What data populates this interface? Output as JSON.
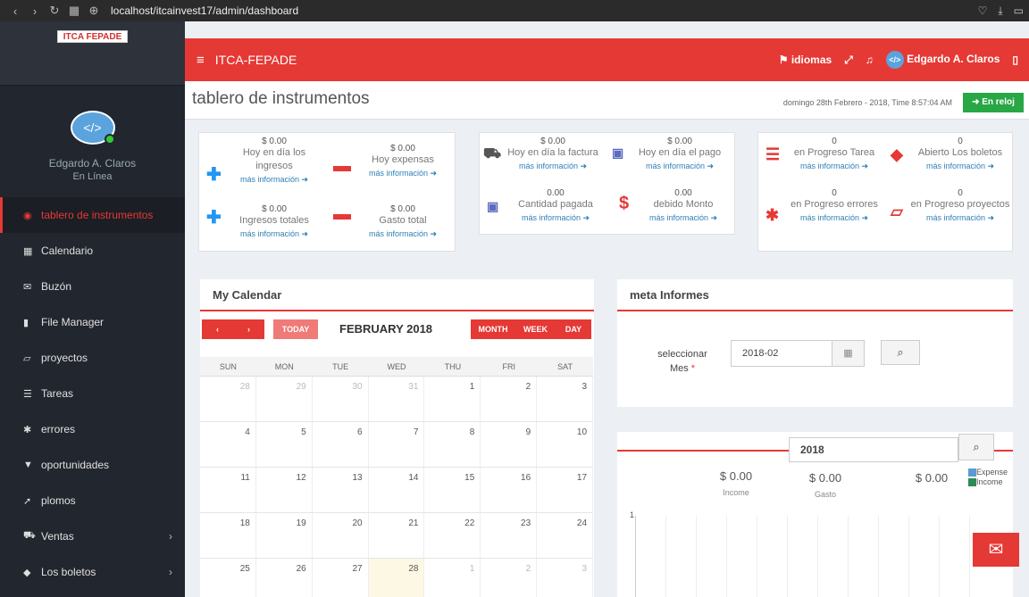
{
  "browser": {
    "url": "localhost/itcainvest17/admin/dashboard"
  },
  "sidebar": {
    "logo": "ITCA FEPADE",
    "user": "Edgardo A. Claros",
    "status": "En Línea",
    "items": [
      {
        "label": "tablero de instrumentos",
        "icon": "dashboard-icon"
      },
      {
        "label": "Calendario",
        "icon": "calendar-icon"
      },
      {
        "label": "Buzón",
        "icon": "envelope-icon"
      },
      {
        "label": "File Manager",
        "icon": "file-icon"
      },
      {
        "label": "proyectos",
        "icon": "folder-icon"
      },
      {
        "label": "Tareas",
        "icon": "tasks-icon"
      },
      {
        "label": "errores",
        "icon": "bug-icon"
      },
      {
        "label": "oportunidades",
        "icon": "filter-icon"
      },
      {
        "label": "plomos",
        "icon": "rocket-icon"
      },
      {
        "label": "Ventas",
        "icon": "cart-icon"
      },
      {
        "label": "Los boletos",
        "icon": "ticket-icon"
      }
    ]
  },
  "topbar": {
    "brand": "ITCA-FEPADE",
    "lang": "idiomas",
    "user": "Edgardo A. Claros"
  },
  "header": {
    "title": "tablero de instrumentos",
    "datetime": "domingo 28th Febrero - 2018, Time  8:57:04 AM",
    "clock_btn": "En reloj"
  },
  "stats": {
    "b1": [
      {
        "v": "$ 0.00",
        "l": "Hoy en día los ingresos",
        "m": "más información"
      },
      {
        "v": "$ 0.00",
        "l": "Hoy expensas",
        "m": "más información"
      },
      {
        "v": "$ 0.00",
        "l": "Ingresos totales",
        "m": "más información"
      },
      {
        "v": "$ 0.00",
        "l": "Gasto total",
        "m": "más información"
      }
    ],
    "b2": [
      {
        "v": "$ 0.00",
        "l": "Hoy en día la factura",
        "m": "más información"
      },
      {
        "v": "$ 0.00",
        "l": "Hoy en día el pago",
        "m": "más información"
      },
      {
        "v": "0.00",
        "l": "Cantidad pagada",
        "m": "más información"
      },
      {
        "v": "0.00",
        "l": "debido Monto",
        "m": "más información"
      }
    ],
    "b3": [
      {
        "v": "0",
        "l": "en Progreso Tarea",
        "m": "más información"
      },
      {
        "v": "0",
        "l": "Abierto Los boletos",
        "m": "más información"
      },
      {
        "v": "0",
        "l": "en Progreso errores",
        "m": "más información"
      },
      {
        "v": "0",
        "l": "en Progreso proyectos",
        "m": "más información"
      }
    ]
  },
  "calendar": {
    "title": "My Calendar",
    "month": "FEBRUARY 2018",
    "today": "TODAY",
    "month_btn": "MONTH",
    "week_btn": "WEEK",
    "day_btn": "DAY",
    "days": [
      "SUN",
      "MON",
      "TUE",
      "WED",
      "THU",
      "FRI",
      "SAT"
    ],
    "weeks": [
      [
        "28",
        "29",
        "30",
        "31",
        "1",
        "2",
        "3"
      ],
      [
        "4",
        "5",
        "6",
        "7",
        "8",
        "9",
        "10"
      ],
      [
        "11",
        "12",
        "13",
        "14",
        "15",
        "16",
        "17"
      ],
      [
        "18",
        "19",
        "20",
        "21",
        "22",
        "23",
        "24"
      ],
      [
        "25",
        "26",
        "27",
        "28",
        "1",
        "2",
        "3"
      ]
    ]
  },
  "meta": {
    "title": "meta Informes",
    "label": "seleccionar Mes",
    "req": "*",
    "value": "2018-02"
  },
  "chart": {
    "year": "2018",
    "items": [
      {
        "v": "$ 0.00",
        "l": "Income"
      },
      {
        "v": "$ 0.00",
        "l": "Gasto"
      },
      {
        "v": "$ 0.00",
        "l": ""
      }
    ],
    "legend": [
      "Expense",
      "Income"
    ],
    "ytick": "1"
  },
  "colors": {
    "accent": "#e53935",
    "link": "#2f7fb6",
    "ok": "#28a745"
  }
}
